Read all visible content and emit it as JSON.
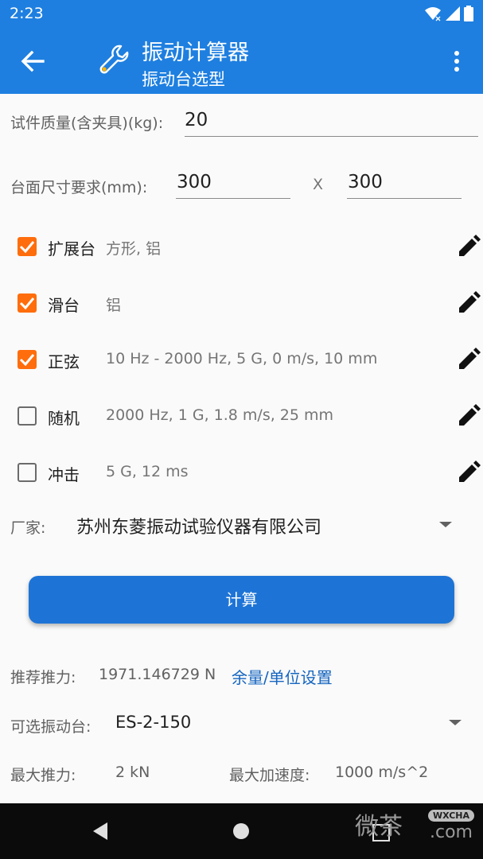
{
  "status_bar": {
    "time": "2:23"
  },
  "app_bar": {
    "title": "振动计算器",
    "subtitle": "振动台选型"
  },
  "mass": {
    "label": "试件质量(含夹具)(kg):",
    "value": "20"
  },
  "table_size": {
    "label": "台面尺寸要求(mm):",
    "width": "300",
    "separator": "X",
    "height": "300"
  },
  "options": [
    {
      "name": "扩展台",
      "desc": "方形, 铝",
      "checked": true
    },
    {
      "name": "滑台",
      "desc": "铝",
      "checked": true
    },
    {
      "name": "正弦",
      "desc": "10 Hz - 2000 Hz, 5 G, 0 m/s, 10 mm",
      "checked": true
    },
    {
      "name": "随机",
      "desc": "2000 Hz, 1 G, 1.8 m/s, 25 mm",
      "checked": false
    },
    {
      "name": "冲击",
      "desc": "5 G, 12 ms",
      "checked": false
    }
  ],
  "manufacturer": {
    "label": "厂家:",
    "value": "苏州东菱振动试验仪器有限公司"
  },
  "calculate_button": "计算",
  "results": {
    "thrust_label": "推荐推力:",
    "thrust_value": "1971.146729 N",
    "margin_link": "余量/单位设置",
    "shaker_label": "可选振动台:",
    "shaker_value": "ES-2-150",
    "max_thrust_label": "最大推力:",
    "max_thrust_value": "2 kN",
    "max_accel_label": "最大加速度:",
    "max_accel_value": "1000 m/s^2"
  },
  "watermark": {
    "text": "微茶",
    "badge": "WXCHA",
    "domain": ".com"
  },
  "colors": {
    "primary": "#1e7fe0",
    "accent": "#ff6d0c",
    "button": "#1e74d6",
    "link": "#1565c0"
  }
}
